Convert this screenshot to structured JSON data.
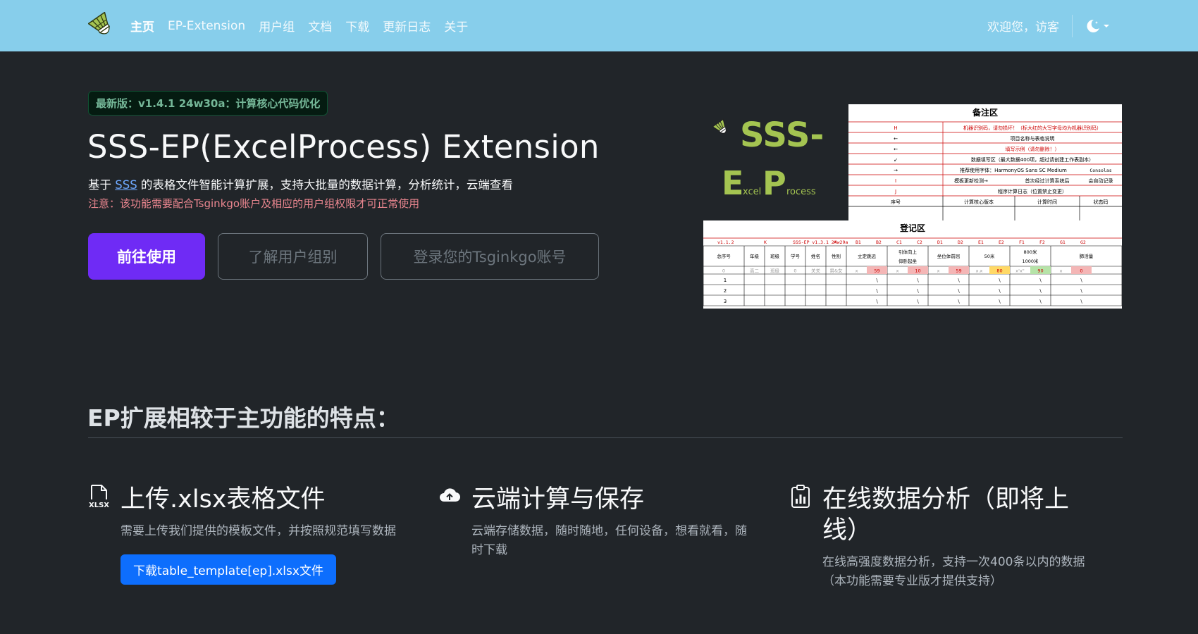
{
  "nav": {
    "links": [
      "主页",
      "EP-Extension",
      "用户组",
      "文档",
      "下载",
      "更新日志",
      "关于"
    ],
    "welcome": "欢迎您，访客"
  },
  "hero": {
    "badge": "最新版：v1.4.1 24w30a：计算核心代码优化",
    "title": "SSS-EP(ExcelProcess) Extension",
    "desc_before": "基于 ",
    "desc_link": "SSS",
    "desc_after": " 的表格文件智能计算扩展，支持大批量的数据计算，分析统计，云端查看",
    "note": "注意：该功能需要配合Tsginkgo账户及相应的用户组权限才可正常使用",
    "btn_primary": "前往使用",
    "btn_learn": "了解用户组别",
    "btn_login": "登录您的Tsginkgo账号"
  },
  "preview": {
    "logo_line1": "SSS-",
    "logo_E": "E",
    "logo_xcel": "xcel",
    "logo_P": "P",
    "logo_rocess": "rocess",
    "notes_title": "备注区",
    "notes_rows": [
      [
        "H",
        "机器识别码，请勿损坏！（标大红的大写字母均为机器识别码）"
      ],
      [
        "←",
        "项目名称与表格说明"
      ],
      [
        "←",
        "填写示例（请勿删除！）"
      ],
      [
        "↙",
        "数据填写区（最大数据400项，超过请创建工作表副本）"
      ],
      [
        "→",
        "推荐使用字体：HarmonyOS Sans SC Medium",
        "Consolas"
      ],
      [
        "I",
        "模板更新检测→",
        "首次经过计算系统后",
        "会自动记录"
      ],
      [
        "J",
        "程序计算日志（位置禁止变更）"
      ]
    ],
    "notes_header": [
      "序号",
      "计算核心版本",
      "计算时间",
      "状态码"
    ],
    "reg_title": "登记区",
    "reg_codes": [
      "v1.1.2",
      "K",
      "SSS-EP v1.3.1 24w29a",
      "A",
      "B1",
      "B2",
      "C1",
      "C2",
      "D1",
      "D2",
      "E1",
      "E2",
      "F1",
      "F2",
      "G1",
      "G2"
    ],
    "reg_headers": [
      "总序号",
      "年级",
      "班级",
      "学号",
      "姓名",
      "性别",
      "立定跳远",
      "引体向上",
      "坐位体前屈",
      "50米",
      "800米",
      "肺活量"
    ],
    "reg_sub": [
      "仰卧起坐",
      "1000米"
    ],
    "reg_example": [
      "0",
      "高二",
      "班级",
      "0",
      "关关",
      "男&女",
      "x",
      "59",
      "x",
      "10",
      "x",
      "59",
      "x.x",
      "80",
      "x'x\"",
      "90",
      "x",
      "0"
    ],
    "reg_rows": [
      "1",
      "2",
      "3"
    ]
  },
  "features": {
    "section_title": "EP扩展相较于主功能的特点：",
    "items": [
      {
        "icon": "file-xlsx-icon",
        "title": "上传.xlsx表格文件",
        "desc": "需要上传我们提供的模板文件，并按照规范填写数据",
        "button": "下载table_template[ep].xlsx文件"
      },
      {
        "icon": "cloud-upload-icon",
        "title": "云端计算与保存",
        "desc1": "云端存储数据，随时随地，任何设备，想看就看，随",
        "desc2": "时下载"
      },
      {
        "icon": "clipboard-data-icon",
        "title1": "在线数据分析（即将上",
        "title2": "线）",
        "desc1": "在线高强度数据分析，支持一次400条以内的数据",
        "desc2": "（本功能需要专业版才提供支持）"
      }
    ]
  },
  "colors": {
    "navbar": "#87ceeb",
    "background": "#212529",
    "primary_button": "#6f2bf5",
    "download_button": "#0d6efd",
    "badge_text": "#75b798",
    "note_text": "#ea868f",
    "logo_green": "#a4c451"
  }
}
